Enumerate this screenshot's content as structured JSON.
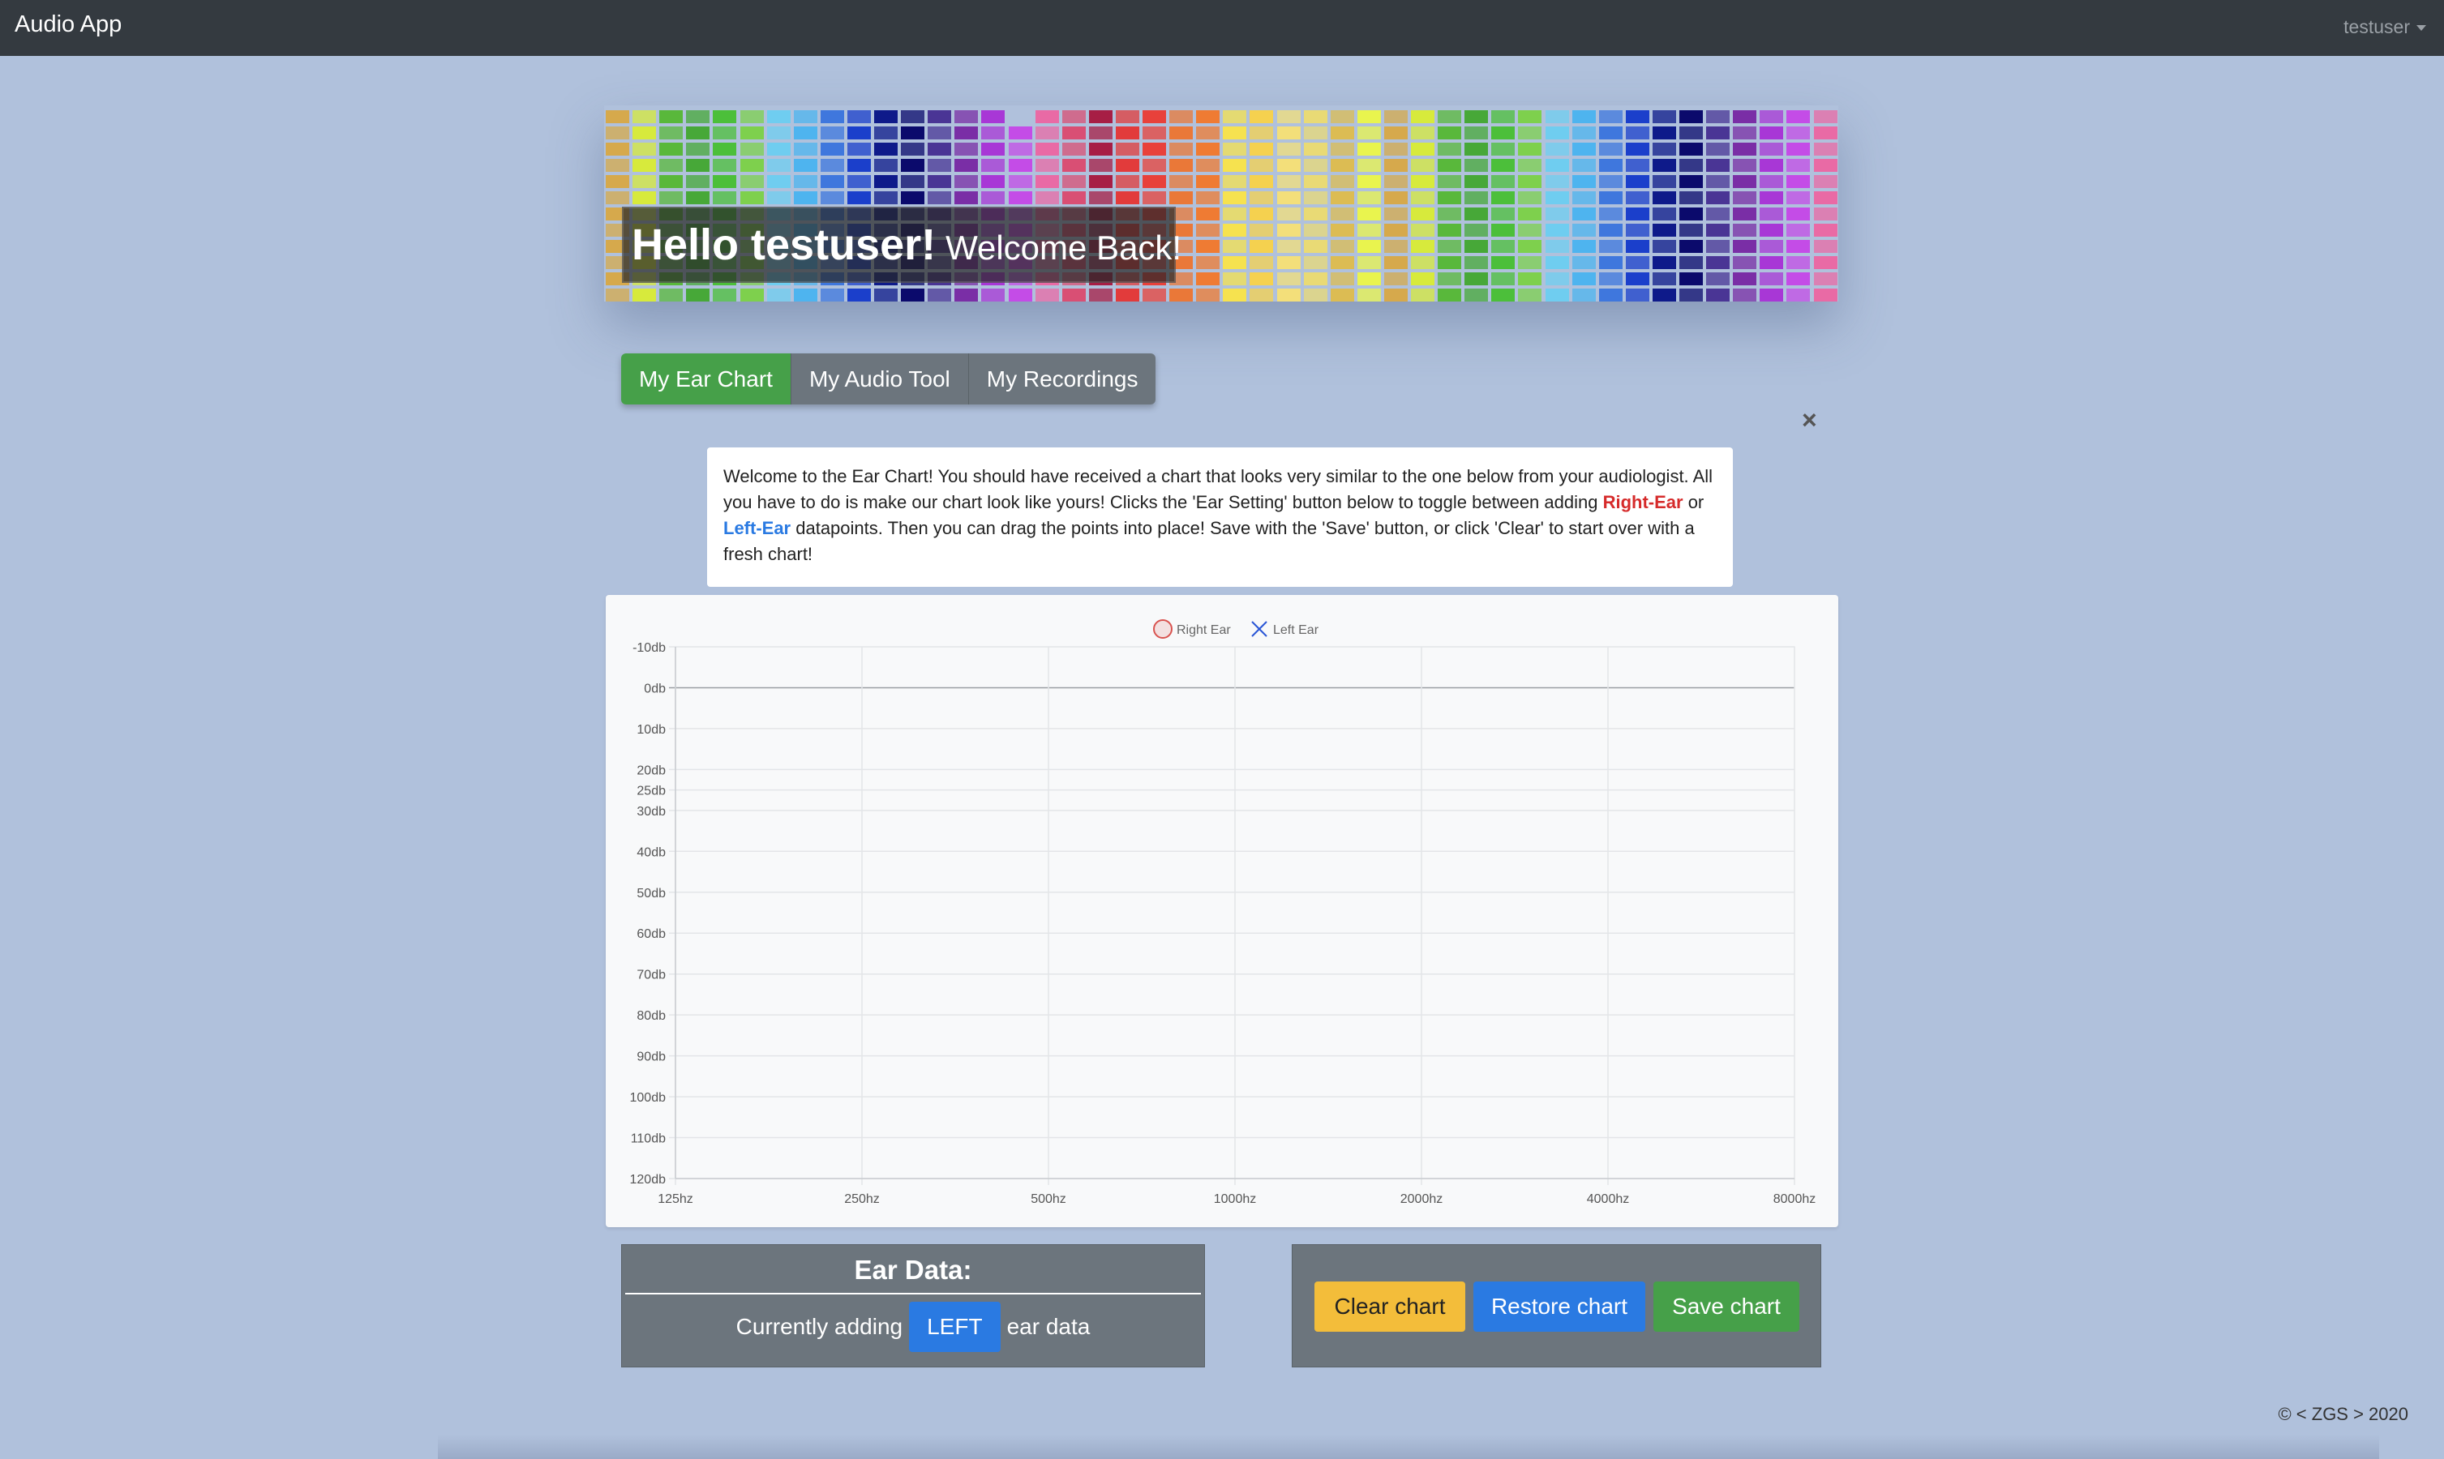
{
  "navbar": {
    "brand": "Audio App",
    "user": "testuser"
  },
  "banner": {
    "greeting_strong": "Hello testuser!",
    "greeting_light": "Welcome Back!",
    "colors": [
      "#d6a94c",
      "#d7ea3c",
      "#59b83b",
      "#47a838",
      "#4cbf3a",
      "#7ed04d",
      "#6fcdf0",
      "#4eb4ef",
      "#3f77dd",
      "#1b3fcb",
      "#0e1a8a",
      "#0b0a6c",
      "#4a3595",
      "#7a2ea6",
      "#a837d6",
      "#c44ce7",
      "#e96aa5",
      "#d94f74",
      "#a71e45",
      "#e23b3b",
      "#e8413b",
      "#ea7838",
      "#ef7b33",
      "#f6e24f",
      "#f5d14f",
      "#f3df7a",
      "#e9da75",
      "#dcbc53",
      "#e9f44e"
    ]
  },
  "tabs": [
    {
      "label": "My Ear Chart",
      "active": true
    },
    {
      "label": "My Audio Tool",
      "active": false
    },
    {
      "label": "My Recordings",
      "active": false
    }
  ],
  "close_label": "×",
  "info": {
    "part1": "Welcome to the Ear Chart! You should have received a chart that looks very similar to the one below from your audiologist. All you have to do is make our chart look like yours! Clicks the 'Ear Setting' button below to toggle between adding ",
    "right_ear": "Right-Ear",
    "or_text": " or ",
    "left_ear": "Left-Ear",
    "part2": " datapoints. Then you can drag the points into place! Save with the 'Save' button, or click 'Clear' to start over with a fresh chart!"
  },
  "chart_data": {
    "type": "scatter",
    "x_categories": [
      "125hz",
      "250hz",
      "500hz",
      "1000hz",
      "2000hz",
      "4000hz",
      "8000hz"
    ],
    "y_ticks": [
      {
        "value": -10,
        "label": "-10db"
      },
      {
        "value": 0,
        "label": "0db"
      },
      {
        "value": 10,
        "label": "10db"
      },
      {
        "value": 20,
        "label": "20db"
      },
      {
        "value": 25,
        "label": "25db"
      },
      {
        "value": 30,
        "label": "30db"
      },
      {
        "value": 40,
        "label": "40db"
      },
      {
        "value": 50,
        "label": "50db"
      },
      {
        "value": 60,
        "label": "60db"
      },
      {
        "value": 70,
        "label": "70db"
      },
      {
        "value": 80,
        "label": "80db"
      },
      {
        "value": 90,
        "label": "90db"
      },
      {
        "value": 100,
        "label": "100db"
      },
      {
        "value": 110,
        "label": "110db"
      },
      {
        "value": 120,
        "label": "120db"
      }
    ],
    "ylim": [
      -10,
      120
    ],
    "y_inverted": true,
    "grid": true,
    "legend_position": "top-center",
    "series": [
      {
        "name": "Right Ear",
        "marker": "circle",
        "color": "#d9534f",
        "points": []
      },
      {
        "name": "Left Ear",
        "marker": "x",
        "color": "#2a56d6",
        "points": []
      }
    ]
  },
  "ear_data": {
    "title": "Ear Data:",
    "prefix": "Currently adding",
    "mode": "LEFT",
    "suffix": "ear data"
  },
  "actions": {
    "clear": "Clear chart",
    "restore": "Restore chart",
    "save": "Save chart"
  },
  "footer": "© < ZGS > 2020"
}
